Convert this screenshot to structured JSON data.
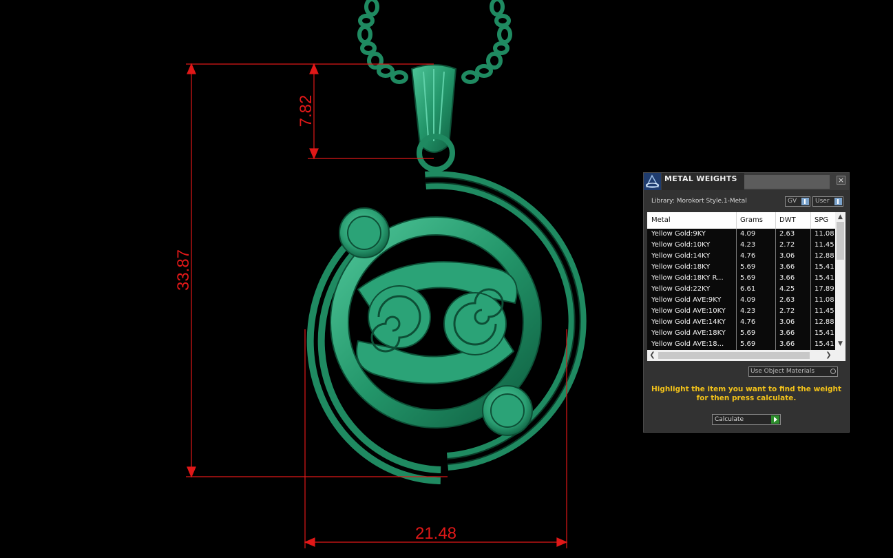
{
  "viewport": {
    "dimensions": {
      "height": "33.87",
      "width": "21.48",
      "bail": "7.82"
    },
    "colors": {
      "metal": "#2aa178",
      "metal_dark": "#147a55",
      "metal_light": "#5fd0a8",
      "dimension": "#e01818",
      "background": "#000000"
    }
  },
  "panel": {
    "title": "METAL WEIGHTS",
    "close_label": "×",
    "icon": "gemvision-logo-icon",
    "library": "Library: Morokort Style.1-Metal",
    "toggles": {
      "gv": "GV",
      "user": "User"
    },
    "columns": [
      "Metal",
      "Grams",
      "DWT",
      "SPG"
    ],
    "rows": [
      [
        "Yellow Gold:9KY",
        "4.09",
        "2.63",
        "11.08"
      ],
      [
        "Yellow Gold:10KY",
        "4.23",
        "2.72",
        "11.45"
      ],
      [
        "Yellow Gold:14KY",
        "4.76",
        "3.06",
        "12.88"
      ],
      [
        "Yellow Gold:18KY",
        "5.69",
        "3.66",
        "15.41"
      ],
      [
        "Yellow Gold:18KY R...",
        "5.69",
        "3.66",
        "15.41"
      ],
      [
        "Yellow Gold:22KY",
        "6.61",
        "4.25",
        "17.89"
      ],
      [
        "Yellow Gold AVE:9KY",
        "4.09",
        "2.63",
        "11.08"
      ],
      [
        "Yellow Gold AVE:10KY",
        "4.23",
        "2.72",
        "11.45"
      ],
      [
        "Yellow Gold AVE:14KY",
        "4.76",
        "3.06",
        "12.88"
      ],
      [
        "Yellow Gold AVE:18KY",
        "5.69",
        "3.66",
        "15.41"
      ],
      [
        "Yellow Gold AVE:18...",
        "5.69",
        "3.66",
        "15.41"
      ]
    ],
    "use_object_materials": "Use Object Materials",
    "instruction_line1": "Highlight the item you want to find the weight",
    "instruction_line2": "for then press calculate.",
    "calculate": "Calculate",
    "accent": "#f2c21a"
  }
}
